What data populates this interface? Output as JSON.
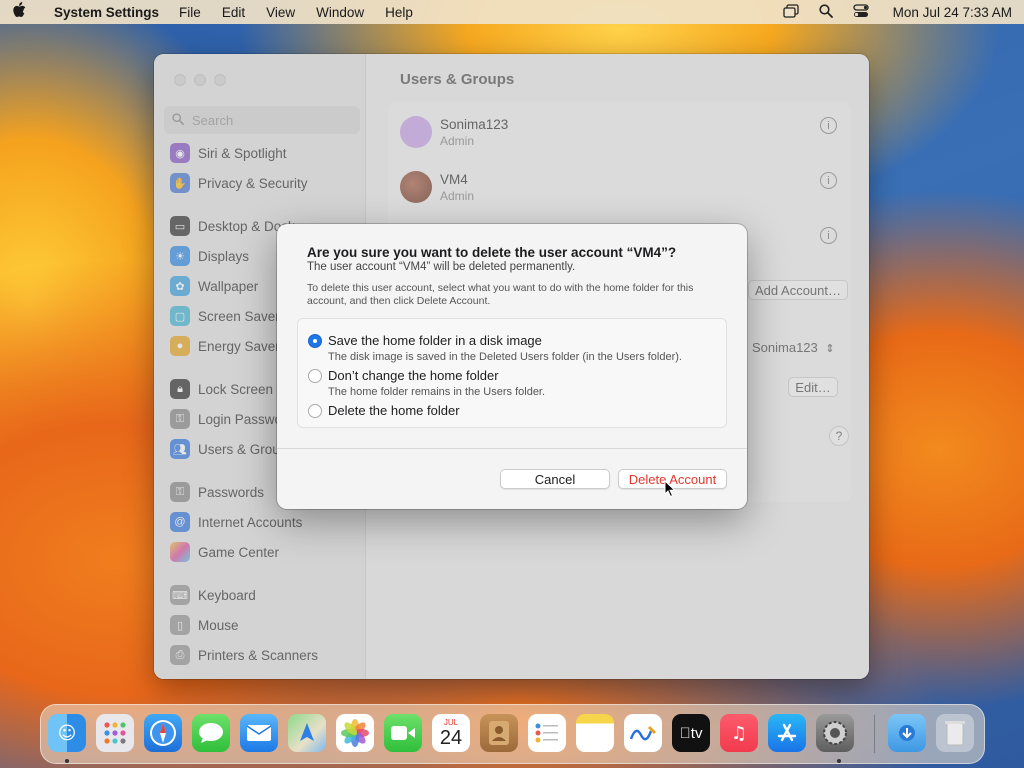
{
  "menubar": {
    "app_name": "System Settings",
    "menus": [
      "File",
      "Edit",
      "View",
      "Window",
      "Help"
    ],
    "clock": "Mon Jul 24  7:33 AM"
  },
  "window": {
    "title": "Users & Groups",
    "search_placeholder": "Search",
    "sidebar": [
      {
        "label": "Siri & Spotlight",
        "color": "#8a5cc9",
        "icon": "siri-icon"
      },
      {
        "label": "Privacy & Security",
        "color": "#4f7ed6",
        "icon": "hand-icon"
      },
      {
        "label": "Desktop & Dock",
        "color": "#3d3d3d",
        "icon": "dock-icon"
      },
      {
        "label": "Displays",
        "color": "#3a8fe6",
        "icon": "sun-icon"
      },
      {
        "label": "Wallpaper",
        "color": "#45a6e0",
        "icon": "flower-icon"
      },
      {
        "label": "Screen Saver",
        "color": "#4cb8d8",
        "icon": "screen-icon"
      },
      {
        "label": "Energy Saver",
        "color": "#e8a92a",
        "icon": "bulb-icon"
      },
      {
        "label": "Lock Screen",
        "color": "#3a3a3a",
        "icon": "lock-icon"
      },
      {
        "label": "Login Password",
        "color": "#8e8e8e",
        "icon": "key-icon"
      },
      {
        "label": "Users & Groups",
        "color": "#3b7de0",
        "icon": "users-icon",
        "selected": true
      },
      {
        "label": "Passwords",
        "color": "#8e8e8e",
        "icon": "key-icon"
      },
      {
        "label": "Internet Accounts",
        "color": "#3b7de0",
        "icon": "at-icon"
      },
      {
        "label": "Game Center",
        "color": "#e05aa6",
        "icon": "game-center-icon"
      },
      {
        "label": "Keyboard",
        "color": "#9a9a9a",
        "icon": "keyboard-icon"
      },
      {
        "label": "Mouse",
        "color": "#9a9a9a",
        "icon": "mouse-icon"
      },
      {
        "label": "Printers & Scanners",
        "color": "#9a9a9a",
        "icon": "printer-icon"
      }
    ],
    "users": [
      {
        "name": "Sonima123",
        "role": "Admin"
      },
      {
        "name": "VM4",
        "role": "Admin"
      }
    ],
    "add_account_label": "Add Account…",
    "auto_login_value": "Sonima123",
    "edit_label": "Edit…",
    "help_label": "?"
  },
  "dialog": {
    "title": "Are you sure you want to delete the user account “VM4”?",
    "subtitle": "The user account “VM4” will be deleted permanently.",
    "description": "To delete this user account, select what you want to do with the home folder for this account, and then click Delete Account.",
    "options": [
      {
        "label": "Save the home folder in a disk image",
        "detail": "The disk image is saved in the Deleted Users folder (in the Users folder).",
        "selected": true
      },
      {
        "label": "Don’t change the home folder",
        "detail": "The home folder remains in the Users folder.",
        "selected": false
      },
      {
        "label": "Delete the home folder",
        "detail": "",
        "selected": false
      }
    ],
    "cancel_label": "Cancel",
    "delete_label": "Delete Account",
    "delete_color": "#e0382e"
  },
  "dock": {
    "calendar_month": "JUL",
    "calendar_day": "24",
    "tv_label": "tv"
  }
}
